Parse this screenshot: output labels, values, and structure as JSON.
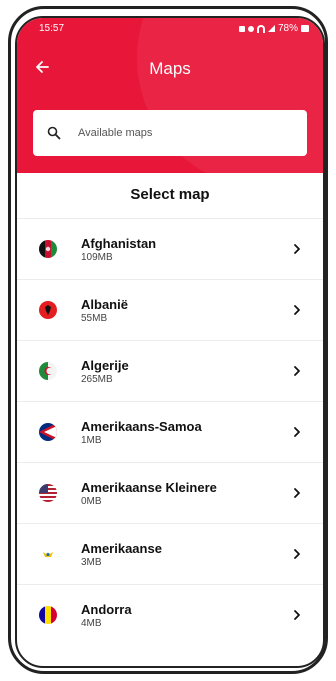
{
  "status": {
    "time": "15:57",
    "battery": "78%"
  },
  "header": {
    "title": "Maps",
    "back_icon": "arrow-left-icon"
  },
  "search": {
    "placeholder": "Available maps",
    "value": ""
  },
  "section_title": "Select map",
  "countries": [
    {
      "name": "Afghanistan",
      "size": "109MB"
    },
    {
      "name": "Albanië",
      "size": "55MB"
    },
    {
      "name": "Algerije",
      "size": "265MB"
    },
    {
      "name": "Amerikaans-Samoa",
      "size": "1MB"
    },
    {
      "name": "Amerikaanse Kleinere",
      "size": "0MB"
    },
    {
      "name": "Amerikaanse",
      "size": "3MB"
    },
    {
      "name": "Andorra",
      "size": "4MB"
    }
  ],
  "colors": {
    "accent": "#e8173a"
  }
}
